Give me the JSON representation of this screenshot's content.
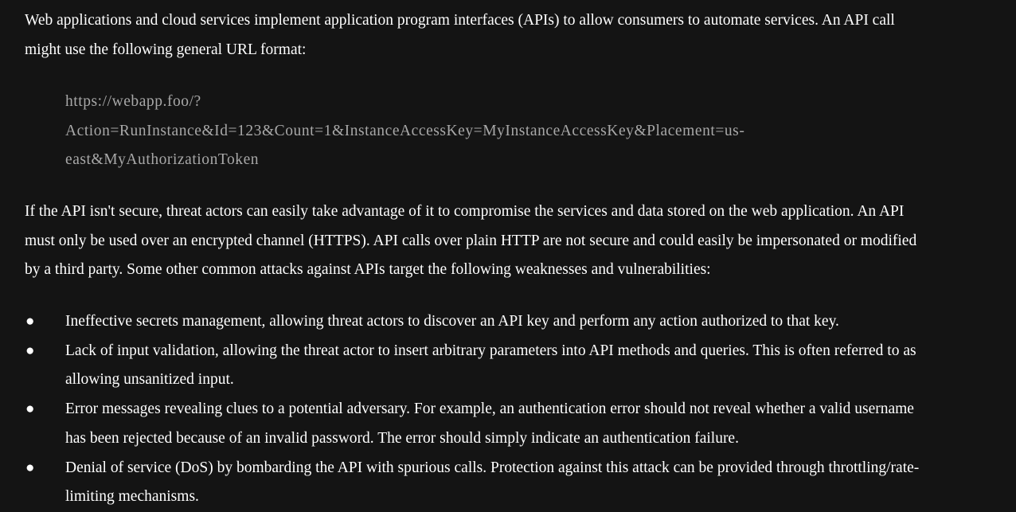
{
  "intro": {
    "lines": [
      "Web applications and cloud services implement application program interfaces (APIs) to allow consumers to automate services. An API call",
      "might use the following general URL format:"
    ]
  },
  "code_example": {
    "lines": [
      "https://webapp.foo/?",
      "Action=RunInstance&Id=123&Count=1&InstanceAccessKey=MyInstanceAccessKey&Placement=us-",
      "east&MyAuthorizationToken"
    ]
  },
  "security": {
    "lines": [
      "If the API isn't secure, threat actors can easily take advantage of it to compromise the services and data stored on the web application. An API",
      "must only be used over an encrypted channel (HTTPS). API calls over plain HTTP are not secure and could easily be impersonated or modified",
      "by a third party. Some other common attacks against APIs target the following weaknesses and vulnerabilities:"
    ]
  },
  "bullet_glyph": "●",
  "bullets": [
    {
      "lines": [
        "Ineffective secrets management, allowing threat actors to discover an API key and perform any action authorized to that key."
      ]
    },
    {
      "lines": [
        "Lack of input validation, allowing the threat actor to insert arbitrary parameters into API methods and queries. This is often referred to as",
        "allowing unsanitized input."
      ]
    },
    {
      "lines": [
        "Error messages revealing clues to a potential adversary. For example, an authentication error should not reveal whether a valid username",
        "has been rejected because of an invalid password. The error should simply indicate an authentication failure."
      ]
    },
    {
      "lines": [
        "Denial of service (DoS) by bombarding the API with spurious calls. Protection against this attack can be provided through throttling/rate-",
        "limiting mechanisms."
      ]
    }
  ]
}
